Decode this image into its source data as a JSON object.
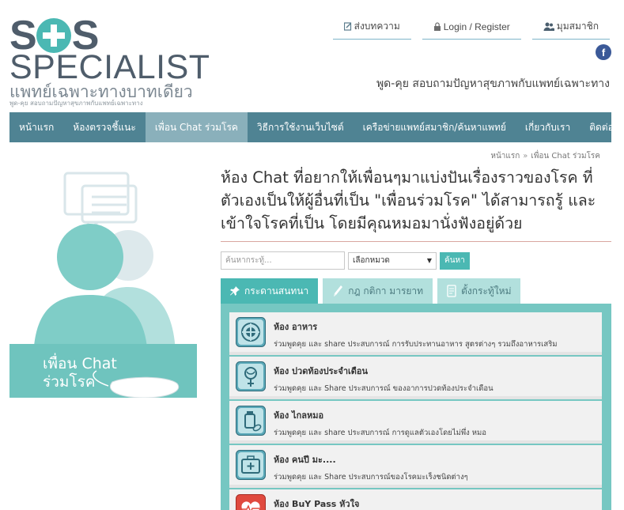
{
  "brand": {
    "logo_letter_1": "S",
    "logo_letter_2": "S",
    "logo_word": "SPECIALIST",
    "logo_thai": "แพทย์เฉพาะทางบาทเดียว",
    "logo_tagline": "พูด-คุย สอบถามปัญหาสุขภาพกับแพทย์เฉพาะทาง",
    "accent_color": "#4bb8b3",
    "nav_color": "#4f8393"
  },
  "top_links": [
    {
      "label": "ส่งบทความ",
      "icon": "edit-icon"
    },
    {
      "label": "Login / Register",
      "icon": "lock-icon"
    },
    {
      "label": "มุมสมาชิก",
      "icon": "users-icon"
    }
  ],
  "facebook": {
    "label": "f"
  },
  "tagline": "พูด-คุย สอบถามปัญหาสุขภาพกับแพทย์เฉพาะทาง",
  "nav": {
    "items": [
      {
        "label": "หน้าแรก"
      },
      {
        "label": "ห้องตรวจชี้แนะ"
      },
      {
        "label": "เพื่อน Chat ร่วมโรค",
        "active": true
      },
      {
        "label": "วิธีการใช้งานเว็บไซต์"
      },
      {
        "label": "เครือข่ายแพทย์สมาชิก/ค้นหาแพทย์"
      },
      {
        "label": "เกี่ยวกับเรา"
      },
      {
        "label": "ติดต่อเรา"
      }
    ]
  },
  "breadcrumb": {
    "home": "หน้าแรก",
    "separator": "»",
    "current": "เพื่อน Chat ร่วมโรค"
  },
  "banner": {
    "line1": "เพื่อน Chat",
    "line2": "ร่วมโรค"
  },
  "page_title": "ห้อง Chat ที่อยากให้เพื่อนๆมาแบ่งปันเรื่องราวของโรค ที่ตัวเองเป็นให้ผู้อื่นที่เป็น \"เพื่อนร่วมโรค\" ได้สามารถรู้ และเข้าใจโรคที่เป็น โดยมีคุณหมอมานั่งฟังอยู่ด้วย",
  "search": {
    "placeholder": "ค้นหากระทู้...",
    "category_selected": "เลือกหมวด",
    "button": "ค้นหา"
  },
  "tabs": [
    {
      "label": "กระดานสนทนา",
      "icon": "pin-icon",
      "active": true
    },
    {
      "label": "กฎ กติกา มารยาท",
      "icon": "pencil-icon"
    },
    {
      "label": "ตั้งกระทู้ใหม่",
      "icon": "document-icon"
    }
  ],
  "rooms": [
    {
      "name": "ห้อง อาหาร",
      "desc": "ร่วมพูดคุย และ share ประสบการณ์ การรับประทานอาหาร สูตรต่างๆ รวมถึงอาหารเสริม",
      "icon": "food-icon"
    },
    {
      "name": "ห้อง ปวดท้องประจำเดือน",
      "desc": "ร่วมพูดคุย และ Share ประสบการณ์ ของอาการปวดท้องประจำเดือน",
      "icon": "female-icon"
    },
    {
      "name": "ห้อง ไกลหมอ",
      "desc": "ร่วมพูดคุย และ share ประสบการณ์ การดูแลตัวเองโดยไม่พึ่ง หมอ",
      "icon": "medicine-bottle-icon"
    },
    {
      "name": "ห้อง คนปี มะ....",
      "desc": "ร่วมพูดคุย และ Share ประสบการณ์ของโรคมะเร็งชนิดต่างๆ",
      "icon": "first-aid-icon"
    },
    {
      "name": "ห้อง BuY Pass หัวใจ",
      "desc": "",
      "icon": "heart-monitor-icon"
    }
  ]
}
